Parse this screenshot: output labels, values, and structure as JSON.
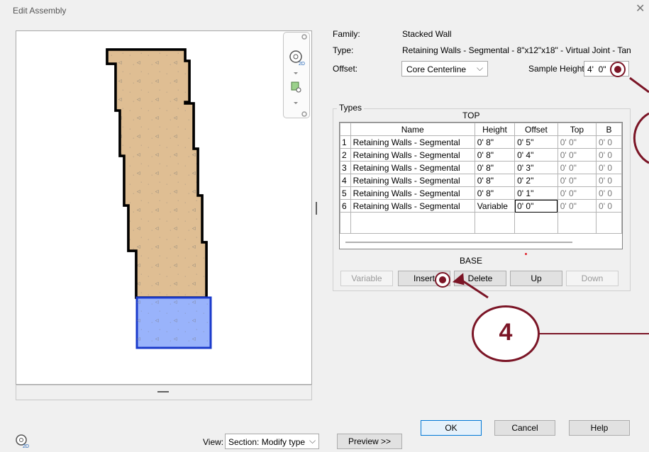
{
  "dialog": {
    "title": "Edit Assembly",
    "close_glyph": "✕"
  },
  "props": {
    "family_label": "Family:",
    "family_value": "Stacked Wall",
    "type_label": "Type:",
    "type_value": "Retaining Walls - Segmental - 8\"x12\"x18\" - Virtual Joint - Tan",
    "offset_label": "Offset:",
    "offset_value": "Core Centerline",
    "sample_height_label": "Sample Height:",
    "sample_height_value": "4'  0\""
  },
  "types": {
    "group_label": "Types",
    "top_label": "TOP",
    "base_label": "BASE",
    "columns": [
      "Name",
      "Height",
      "Offset",
      "Top",
      "B"
    ],
    "rows": [
      {
        "n": "1",
        "name": "Retaining Walls - Segmental",
        "height": "0'  8\"",
        "offset": "0'  5\"",
        "top": "0'  0\"",
        "b": "0'  0"
      },
      {
        "n": "2",
        "name": "Retaining Walls - Segmental",
        "height": "0'  8\"",
        "offset": "0'  4\"",
        "top": "0'  0\"",
        "b": "0'  0"
      },
      {
        "n": "3",
        "name": "Retaining Walls - Segmental",
        "height": "0'  8\"",
        "offset": "0'  3\"",
        "top": "0'  0\"",
        "b": "0'  0"
      },
      {
        "n": "4",
        "name": "Retaining Walls - Segmental",
        "height": "0'  8\"",
        "offset": "0'  2\"",
        "top": "0'  0\"",
        "b": "0'  0"
      },
      {
        "n": "5",
        "name": "Retaining Walls - Segmental",
        "height": "0'  8\"",
        "offset": "0'  1\"",
        "top": "0'  0\"",
        "b": "0'  0"
      },
      {
        "n": "6",
        "name": "Retaining Walls - Segmental",
        "height": "Variable",
        "offset": "0'  0\"",
        "top": "0'  0\"",
        "b": "0'  0"
      }
    ]
  },
  "buttons": {
    "variable": "Variable",
    "insert": "Insert",
    "delete": "Delete",
    "up": "Up",
    "down": "Down",
    "ok": "OK",
    "cancel": "Cancel",
    "help": "Help",
    "preview": "Preview >>"
  },
  "view": {
    "label": "View:",
    "value": "Section: Modify type"
  },
  "callout": {
    "number": "4",
    "color": "#7b1526"
  },
  "colors": {
    "wall_tan": "#dcb98a",
    "wall_blue": "#99b3fb",
    "blue_outline": "#1a3acb"
  }
}
